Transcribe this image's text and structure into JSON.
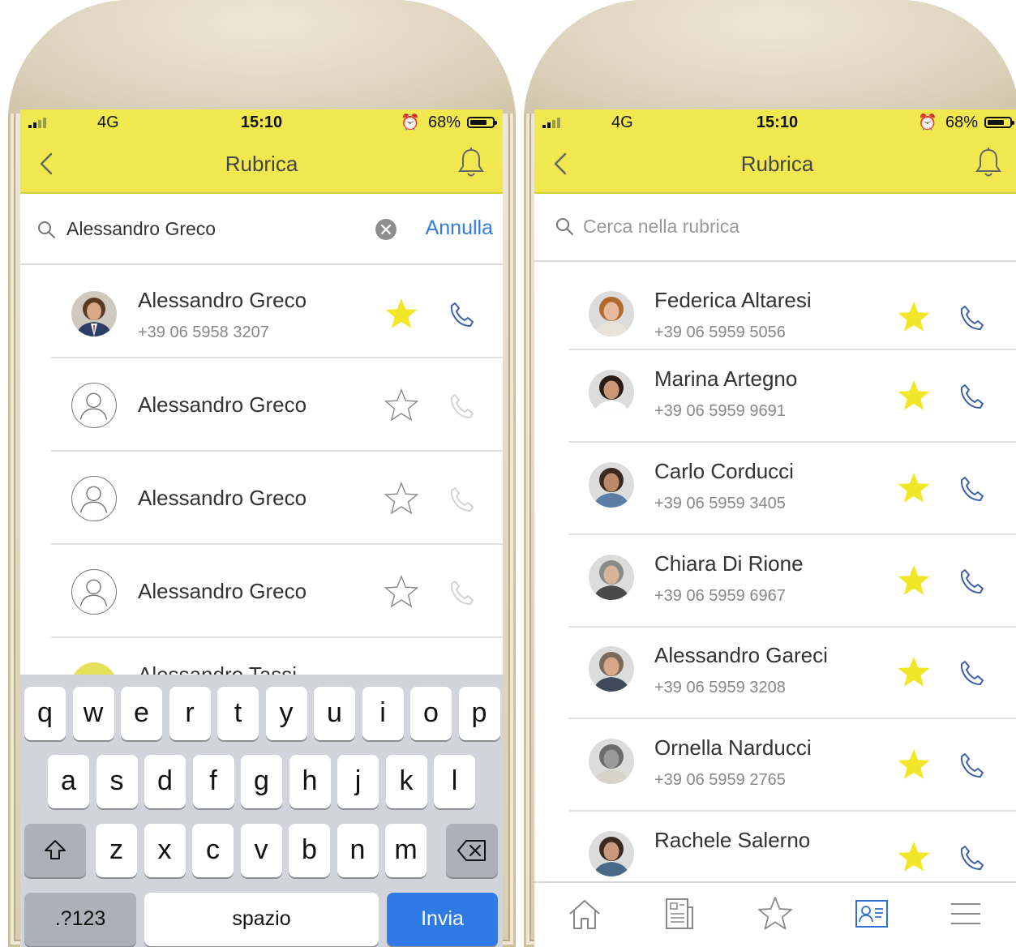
{
  "left_phone": {
    "status": {
      "network": "4G",
      "time": "15:10",
      "battery": "68%"
    },
    "nav": {
      "title": "Rubrica"
    },
    "search": {
      "value": "Alessandro Greco",
      "cancel_label": "Annulla"
    },
    "results": [
      {
        "name": "Alessandro Greco",
        "phone": "+39 06 5958 3207",
        "favorite": true,
        "has_photo": true
      },
      {
        "name": "Alessandro Greco",
        "phone": "",
        "favorite": false,
        "has_photo": false
      },
      {
        "name": "Alessandro Greco",
        "phone": "",
        "favorite": false,
        "has_photo": false
      },
      {
        "name": "Alessandro Greco",
        "phone": "",
        "favorite": false,
        "has_photo": false
      },
      {
        "name": "Alessandro Tassi",
        "phone": "",
        "favorite": false,
        "has_photo": true
      }
    ],
    "keyboard": {
      "row1": [
        "q",
        "w",
        "e",
        "r",
        "t",
        "y",
        "u",
        "i",
        "o",
        "p"
      ],
      "row2": [
        "a",
        "s",
        "d",
        "f",
        "g",
        "h",
        "j",
        "k",
        "l"
      ],
      "row3": [
        "z",
        "x",
        "c",
        "v",
        "b",
        "n",
        "m"
      ],
      "numbers_label": ".?123",
      "space_label": "spazio",
      "send_label": "Invia"
    }
  },
  "right_phone": {
    "status": {
      "network": "4G",
      "time": "15:10",
      "battery": "68%"
    },
    "nav": {
      "title": "Rubrica"
    },
    "search": {
      "placeholder": "Cerca nella rubrica"
    },
    "contacts": [
      {
        "name": "Federica Altaresi",
        "phone": "+39 06 5959 5056",
        "favorite": true
      },
      {
        "name": "Marina Artegno",
        "phone": "+39 06 5959 9691",
        "favorite": true
      },
      {
        "name": "Carlo Corducci",
        "phone": "+39 06 5959 3405",
        "favorite": true
      },
      {
        "name": "Chiara Di Rione",
        "phone": "+39 06 5959 6967",
        "favorite": true
      },
      {
        "name": "Alessandro Gareci",
        "phone": "+39 06 5959 3208",
        "favorite": true
      },
      {
        "name": "Ornella Narducci",
        "phone": "+39 06 5959 2765",
        "favorite": true
      },
      {
        "name": "Rachele Salerno",
        "phone": "",
        "favorite": true
      }
    ],
    "tabs": [
      "home-icon",
      "news-icon",
      "favorites-icon",
      "contacts-icon",
      "menu-icon"
    ],
    "active_tab": "contacts-icon"
  },
  "colors": {
    "header_yellow": "#f1e850",
    "star_yellow": "#f2e628",
    "link_blue": "#2f7de0",
    "call_blue": "#3b5fa8"
  }
}
